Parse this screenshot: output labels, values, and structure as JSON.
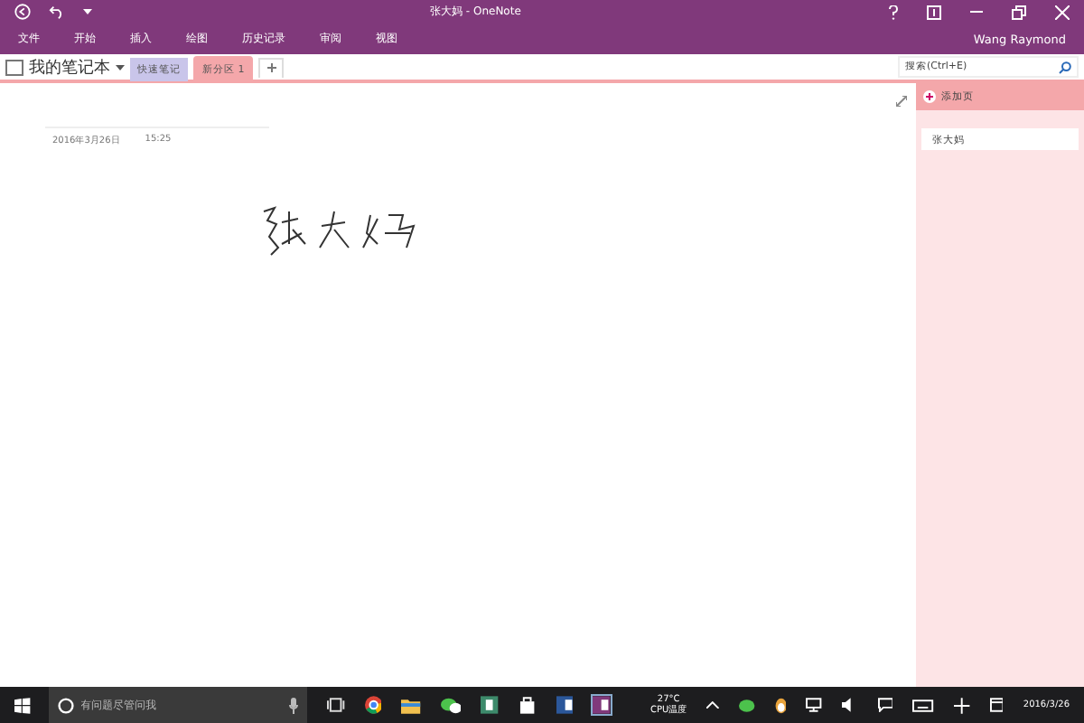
{
  "window": {
    "title": "张大妈 - OneNote",
    "user": "Wang Raymond"
  },
  "ribbon_tabs": [
    "文件",
    "开始",
    "插入",
    "绘图",
    "历史记录",
    "审阅",
    "视图"
  ],
  "notebook": {
    "name": "我的笔记本"
  },
  "sections": [
    {
      "label": "快速笔记",
      "color": "#c9c5ea",
      "selected": false
    },
    {
      "label": "新分区 1",
      "color": "#f4a7aa",
      "selected": true
    }
  ],
  "search": {
    "placeholder": "搜索(Ctrl+E)"
  },
  "page": {
    "date": "2016年3月26日",
    "time": "15:25"
  },
  "page_pane": {
    "add_page": "添加页",
    "pages": [
      {
        "title": "张大妈",
        "selected": true
      }
    ]
  },
  "taskbar": {
    "search_placeholder": "有问题尽管问我",
    "temperature": "27°C",
    "temperature_label": "CPU温度",
    "date": "2016/3/26"
  }
}
